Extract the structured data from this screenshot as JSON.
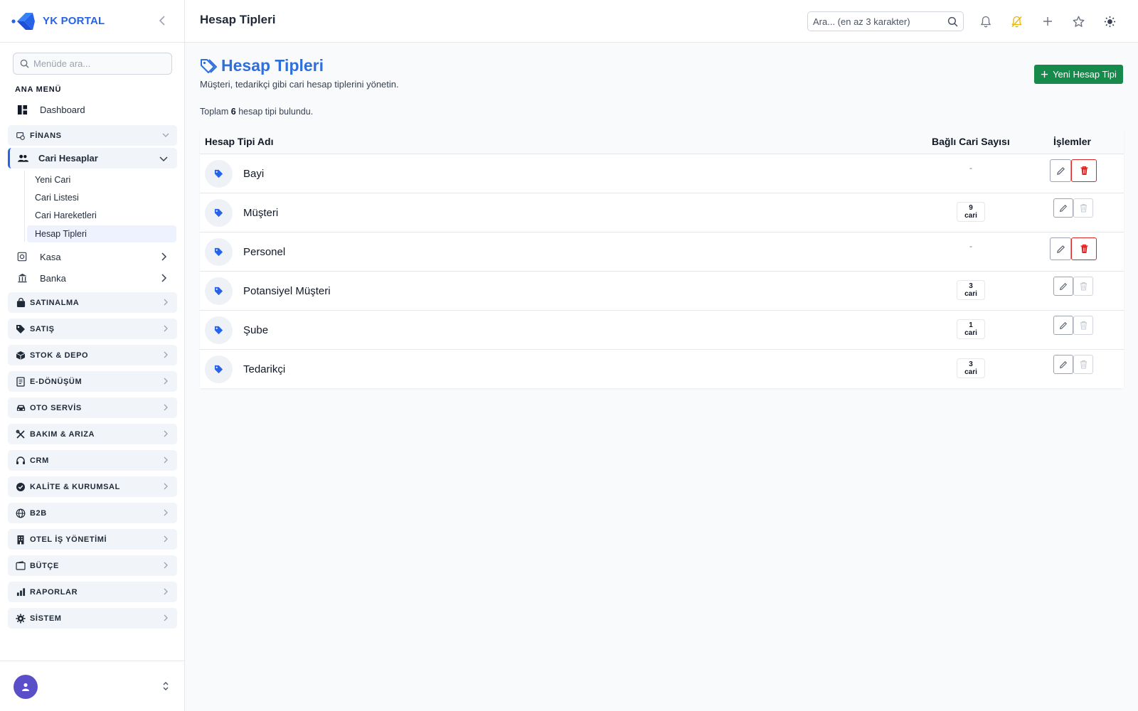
{
  "brand": {
    "name": "YK PORTAL",
    "color": "#2563eb"
  },
  "sidebar": {
    "search_placeholder": "Menüde ara...",
    "section_title": "ANA MENÜ",
    "dashboard": {
      "label": "Dashboard",
      "icon": "dashboard-icon"
    },
    "finans": {
      "label": "FİNANS",
      "icon": "finance-icon",
      "expanded": true,
      "cari": {
        "label": "Cari Hesaplar",
        "icon": "users-icon",
        "expanded": true,
        "items": [
          "Yeni Cari",
          "Cari Listesi",
          "Cari Hareketleri",
          "Hesap Tipleri"
        ],
        "active": "Hesap Tipleri"
      },
      "kasa": {
        "label": "Kasa",
        "icon": "safe-icon"
      },
      "banka": {
        "label": "Banka",
        "icon": "bank-icon"
      }
    },
    "groups": [
      {
        "label": "SATINALMA",
        "icon": "shopping-bag-icon"
      },
      {
        "label": "SATIŞ",
        "icon": "tag-icon"
      },
      {
        "label": "STOK & DEPO",
        "icon": "box-icon"
      },
      {
        "label": "E-DÖNÜŞÜM",
        "icon": "document-icon"
      },
      {
        "label": "OTO SERVİS",
        "icon": "car-icon"
      },
      {
        "label": "BAKIM & ARIZA",
        "icon": "tools-icon"
      },
      {
        "label": "CRM",
        "icon": "headset-icon"
      },
      {
        "label": "KALİTE & KURUMSAL",
        "icon": "certificate-icon"
      },
      {
        "label": "B2B",
        "icon": "globe-icon"
      },
      {
        "label": "OTEL İŞ YÖNETİMİ",
        "icon": "building-icon"
      },
      {
        "label": "BÜTÇE",
        "icon": "wallet-icon"
      },
      {
        "label": "RAPORLAR",
        "icon": "chart-icon"
      },
      {
        "label": "SİSTEM",
        "icon": "gear-icon"
      }
    ]
  },
  "topbar": {
    "title": "Hesap Tipleri",
    "search_placeholder": "Ara... (en az 3 karakter)",
    "icons": [
      "bell-icon",
      "bell-off-icon",
      "plus-icon",
      "star-icon",
      "sun-icon"
    ]
  },
  "page": {
    "title": "Hesap Tipleri",
    "subtitle": "Müşteri, tedarikçi gibi cari hesap tiplerini yönetin.",
    "new_button": "Yeni Hesap Tipi",
    "count_prefix": "Toplam",
    "count_value": "6",
    "count_suffix": "hesap tipi bulundu."
  },
  "table": {
    "columns": [
      "Hesap Tipi Adı",
      "Bağlı Cari Sayısı",
      "İşlemler"
    ],
    "rows": [
      {
        "name": "Bayi",
        "count": "-",
        "deletable": true
      },
      {
        "name": "Müşteri",
        "count": "9 cari",
        "deletable": false
      },
      {
        "name": "Personel",
        "count": "-",
        "deletable": true
      },
      {
        "name": "Potansiyel Müşteri",
        "count": "3 cari",
        "deletable": false
      },
      {
        "name": "Şube",
        "count": "1 cari",
        "deletable": false
      },
      {
        "name": "Tedarikçi",
        "count": "3 cari",
        "deletable": false
      }
    ]
  },
  "colors": {
    "primary": "#2563eb",
    "success": "#168a4a",
    "danger": "#dc2626",
    "avatar": "#5b4fc9"
  }
}
